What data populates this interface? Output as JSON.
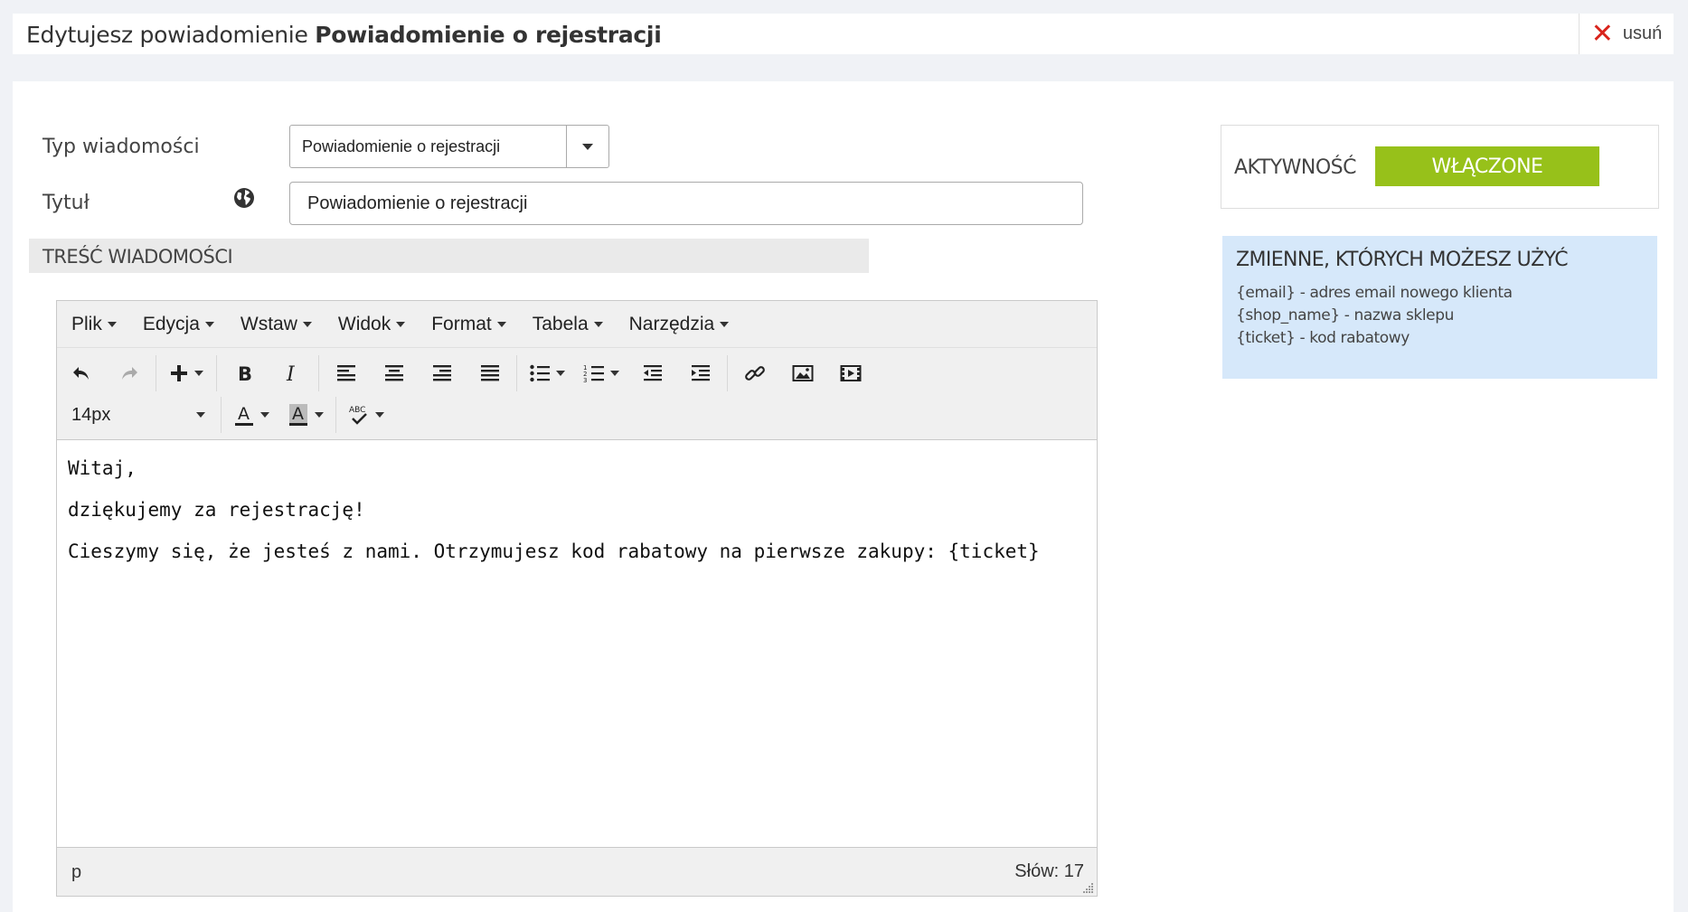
{
  "header": {
    "prefix": "Edytujesz powiadomienie",
    "name": "Powiadomienie o rejestracji",
    "delete_label": "usuń"
  },
  "form": {
    "type_label": "Typ wiadomości",
    "type_value": "Powiadomienie o rejestracji",
    "title_label": "Tytuł",
    "title_value": "Powiadomienie o rejestracji",
    "content_heading": "TREŚĆ WIADOMOŚCI"
  },
  "editor": {
    "menus": [
      "Plik",
      "Edycja",
      "Wstaw",
      "Widok",
      "Format",
      "Tabela",
      "Narzędzia"
    ],
    "font_size": "14px",
    "paragraphs": [
      "Witaj,",
      "dziękujemy za rejestrację!",
      "Cieszymy się, że jesteś z nami. Otrzymujesz kod rabatowy na pierwsze zakupy: {ticket}"
    ],
    "status_path": "p",
    "word_count": "Słów: 17"
  },
  "activity": {
    "label": "AKTYWNOŚĆ",
    "toggle_label": "WŁĄCZONE",
    "toggle_color": "#97c11a"
  },
  "variables": {
    "heading": "ZMIENNE, KTÓRYCH MOŻESZ UŻYĆ",
    "items": [
      "{email} - adres email nowego klienta",
      "{shop_name} - nazwa sklepu",
      "{ticket} - kod rabatowy"
    ]
  },
  "colors": {
    "delete": "#d9241c",
    "variables_bg": "#d6e8fa"
  }
}
